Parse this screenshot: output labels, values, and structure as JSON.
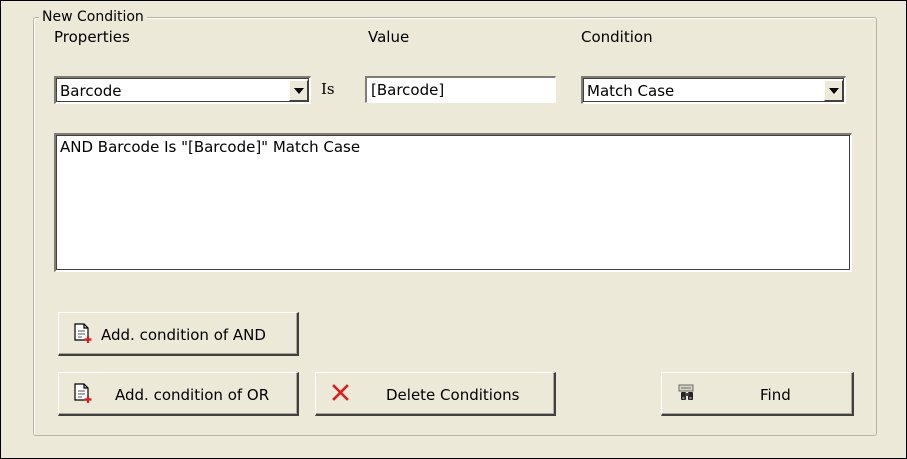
{
  "group": {
    "title": "New Condition"
  },
  "labels": {
    "properties": "Properties",
    "value": "Value",
    "condition": "Condition",
    "is": "Is"
  },
  "properties_combo": {
    "selected": "Barcode"
  },
  "value_field": {
    "value": "[Barcode]"
  },
  "condition_combo": {
    "selected": "Match Case"
  },
  "conditions_text": "AND Barcode Is \"[Barcode]\" Match Case",
  "buttons": {
    "add_and": "Add. condition of AND",
    "add_or": "Add. condition of OR",
    "delete": "Delete Conditions",
    "find": "Find"
  },
  "icons": {
    "add_and": "document-add-icon",
    "add_or": "document-add-icon",
    "delete": "red-x-icon",
    "find": "binoculars-icon"
  },
  "colors": {
    "background": "#ece9d8",
    "delete_icon": "#d42020",
    "add_plus": "#d42020"
  }
}
